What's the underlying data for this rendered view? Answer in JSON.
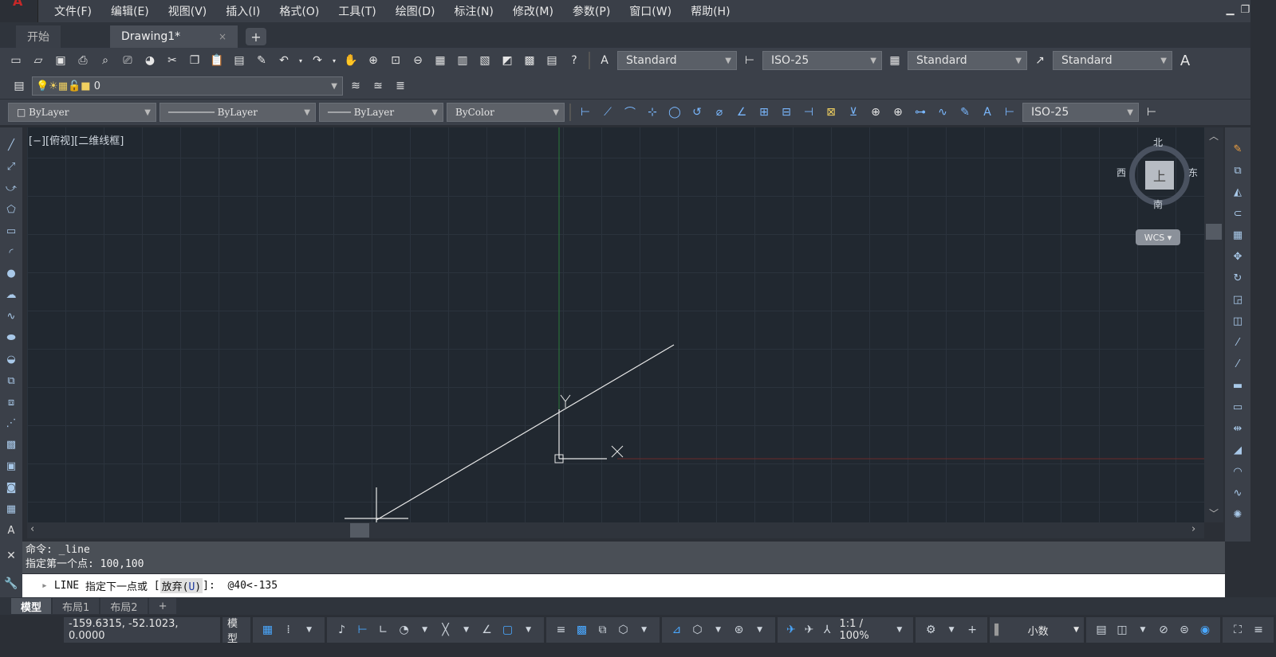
{
  "menu": [
    "文件(F)",
    "编辑(E)",
    "视图(V)",
    "插入(I)",
    "格式(O)",
    "工具(T)",
    "绘图(D)",
    "标注(N)",
    "修改(M)",
    "参数(P)",
    "窗口(W)",
    "帮助(H)"
  ],
  "tabs": {
    "start": "开始",
    "drawing": "Drawing1*",
    "close": "×",
    "add": "+"
  },
  "styles": {
    "text_style": "Standard",
    "dim_style": "ISO-25",
    "table_style": "Standard",
    "mleader_style": "Standard"
  },
  "layer": {
    "name": "0"
  },
  "properties": {
    "color": "ByLayer",
    "linetype": "ByLayer",
    "lineweight": "ByLayer",
    "plotstyle": "ByColor",
    "dim_style_2": "ISO-25"
  },
  "viewport": {
    "label": "[−][俯视][二维线框]",
    "compass": {
      "north": "北",
      "south": "南",
      "east": "东",
      "west": "西",
      "top": "上",
      "ucs": "WCS"
    }
  },
  "command": {
    "history": [
      "命令: _line",
      "指定第一个点: 100,100"
    ],
    "prompt_cmd": "LINE",
    "prompt_text": "指定下一点或",
    "prompt_option_label": "放弃(",
    "prompt_option_key": "U",
    "prompt_option_end": ")",
    "prompt_suffix": "]:",
    "input": "@40<-135"
  },
  "layout_tabs": [
    "模型",
    "布局1",
    "布局2"
  ],
  "status": {
    "coords": "-159.6315, -52.1023, 0.0000",
    "space": "模型",
    "scale": "1:1 / 100%",
    "units": "小数"
  },
  "colors": {
    "background": "#212830",
    "toolbar": "#3b4049",
    "ucs_x": "#8b2a2a",
    "ucs_y": "#2a7a3a"
  }
}
